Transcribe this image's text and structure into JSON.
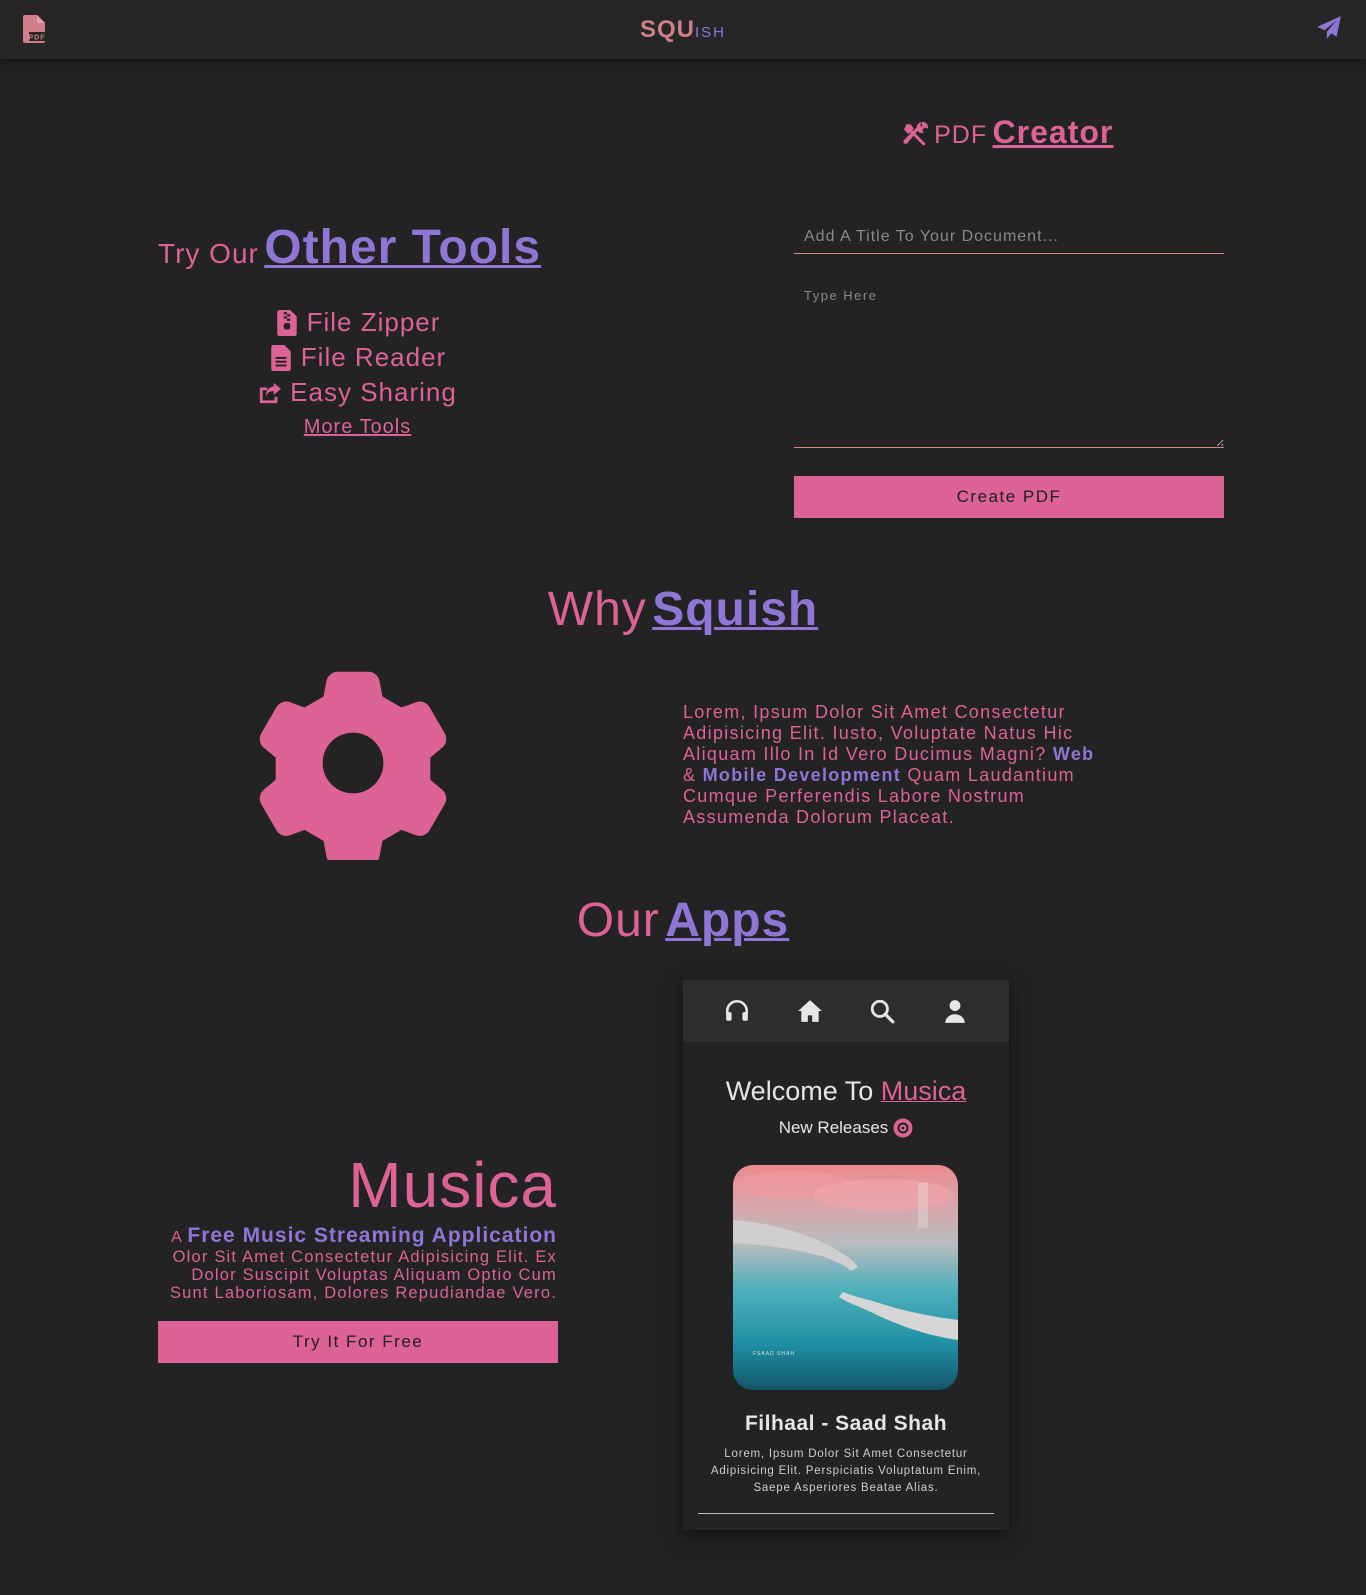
{
  "navbar": {
    "logo_icon": "pdf-file-icon",
    "brand_main": "SQU",
    "brand_sub": "ISH",
    "send_icon": "paper-plane-icon"
  },
  "tools": {
    "title_prefix": "Try Our",
    "title_main": "Other Tools",
    "items": [
      {
        "icon": "file-zip-icon",
        "label": "File Zipper"
      },
      {
        "icon": "file-text-icon",
        "label": "File Reader"
      },
      {
        "icon": "share-icon",
        "label": "Easy Sharing"
      }
    ],
    "more_label": "More Tools"
  },
  "pdf_creator": {
    "icon": "tools-icon",
    "title_prefix": "PDF",
    "title_main": "Creator",
    "title_placeholder": "Add A Title To Your Document...",
    "body_placeholder": "Type Here",
    "button_label": "Create PDF"
  },
  "why": {
    "title_prefix": "Why",
    "title_main": "Squish",
    "icon": "gear-icon",
    "text_part1": "Lorem, Ipsum Dolor Sit Amet Consectetur Adipisicing Elit. Iusto, Voluptate Natus Hic Aliquam Illo In Id Vero Ducimus Magni?",
    "highlight1": "Web",
    "amp": "&",
    "highlight2": "Mobile Development",
    "text_part2": "Quam Laudantium Cumque Perferendis Labore Nostrum Assumenda Dolorum Placeat."
  },
  "apps": {
    "title_prefix": "Our",
    "title_main": "Apps",
    "musica": {
      "name": "Musica",
      "tag_prefix": "A",
      "tag_main": "Free Music Streaming Application",
      "description": "Olor Sit Amet Consectetur Adipisicing Elit. Ex Dolor Suscipit Voluptas Aliquam Optio Cum Sunt Laboriosam, Dolores Repudiandae Vero.",
      "button_label": "Try It For Free"
    },
    "phone": {
      "nav_icons": [
        "headphones-icon",
        "home-icon",
        "search-icon",
        "user-icon"
      ],
      "welcome_prefix": "Welcome To",
      "welcome_brand": "Musica",
      "new_releases": "New Releases",
      "song_title": "Filhaal - Saad Shah",
      "song_description": "Lorem, Ipsum Dolor Sit Amet Consectetur Adipisicing Elit. Perspiciatis Voluptatum Enim, Saepe Asperiores Beatae Alias."
    }
  },
  "colors": {
    "background": "#232323",
    "navbar": "#262626",
    "pink": "#dd6295",
    "purple": "#8f76d6"
  }
}
